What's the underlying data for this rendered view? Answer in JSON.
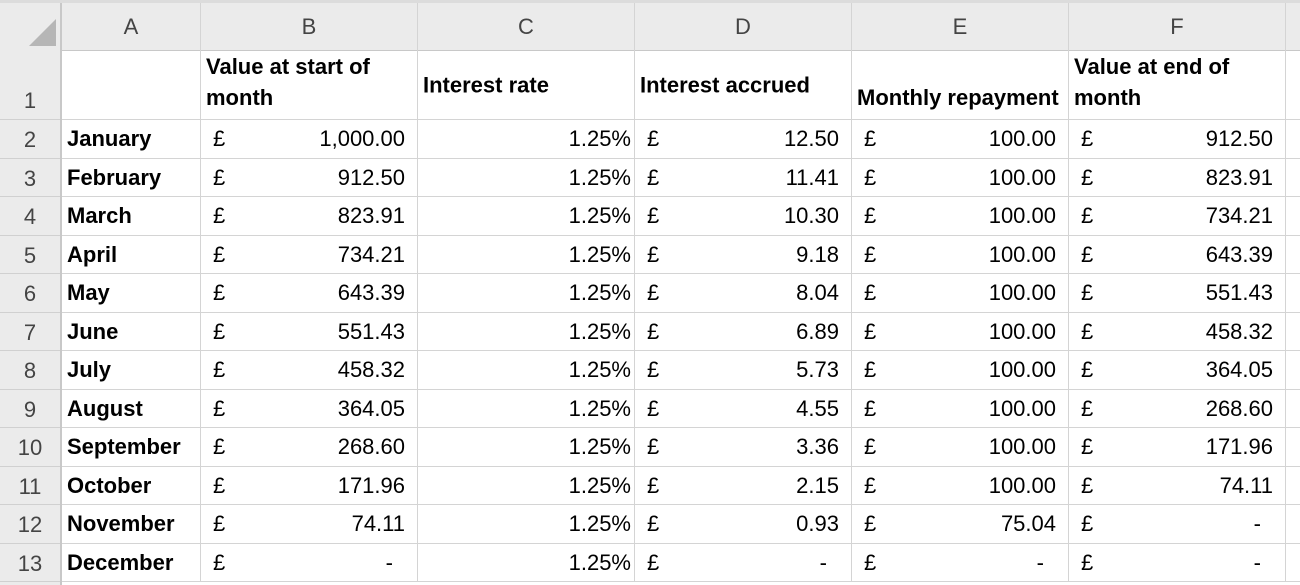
{
  "sheet": {
    "column_headers": [
      "A",
      "B",
      "C",
      "D",
      "E",
      "F"
    ],
    "row_numbers": [
      "1",
      "2",
      "3",
      "4",
      "5",
      "6",
      "7",
      "8",
      "9",
      "10",
      "11",
      "12",
      "13"
    ],
    "header_row": {
      "a": "",
      "b": "Value at start of month",
      "c": "Interest rate",
      "d": "Interest accrued",
      "e": "Monthly repayment",
      "f": "Value at end of month"
    },
    "currency_symbol": "£",
    "rows": [
      {
        "month": "January",
        "start": "1,000.00",
        "rate": "1.25%",
        "interest": "12.50",
        "repayment": "100.00",
        "end": "912.50"
      },
      {
        "month": "February",
        "start": "912.50",
        "rate": "1.25%",
        "interest": "11.41",
        "repayment": "100.00",
        "end": "823.91"
      },
      {
        "month": "March",
        "start": "823.91",
        "rate": "1.25%",
        "interest": "10.30",
        "repayment": "100.00",
        "end": "734.21"
      },
      {
        "month": "April",
        "start": "734.21",
        "rate": "1.25%",
        "interest": "9.18",
        "repayment": "100.00",
        "end": "643.39"
      },
      {
        "month": "May",
        "start": "643.39",
        "rate": "1.25%",
        "interest": "8.04",
        "repayment": "100.00",
        "end": "551.43"
      },
      {
        "month": "June",
        "start": "551.43",
        "rate": "1.25%",
        "interest": "6.89",
        "repayment": "100.00",
        "end": "458.32"
      },
      {
        "month": "July",
        "start": "458.32",
        "rate": "1.25%",
        "interest": "5.73",
        "repayment": "100.00",
        "end": "364.05"
      },
      {
        "month": "August",
        "start": "364.05",
        "rate": "1.25%",
        "interest": "4.55",
        "repayment": "100.00",
        "end": "268.60"
      },
      {
        "month": "September",
        "start": "268.60",
        "rate": "1.25%",
        "interest": "3.36",
        "repayment": "100.00",
        "end": "171.96"
      },
      {
        "month": "October",
        "start": "171.96",
        "rate": "1.25%",
        "interest": "2.15",
        "repayment": "100.00",
        "end": "74.11"
      },
      {
        "month": "November",
        "start": "74.11",
        "rate": "1.25%",
        "interest": "0.93",
        "repayment": "75.04",
        "end": "-"
      },
      {
        "month": "December",
        "start": "-",
        "rate": "1.25%",
        "interest": "-",
        "repayment": "-",
        "end": "-"
      }
    ]
  }
}
